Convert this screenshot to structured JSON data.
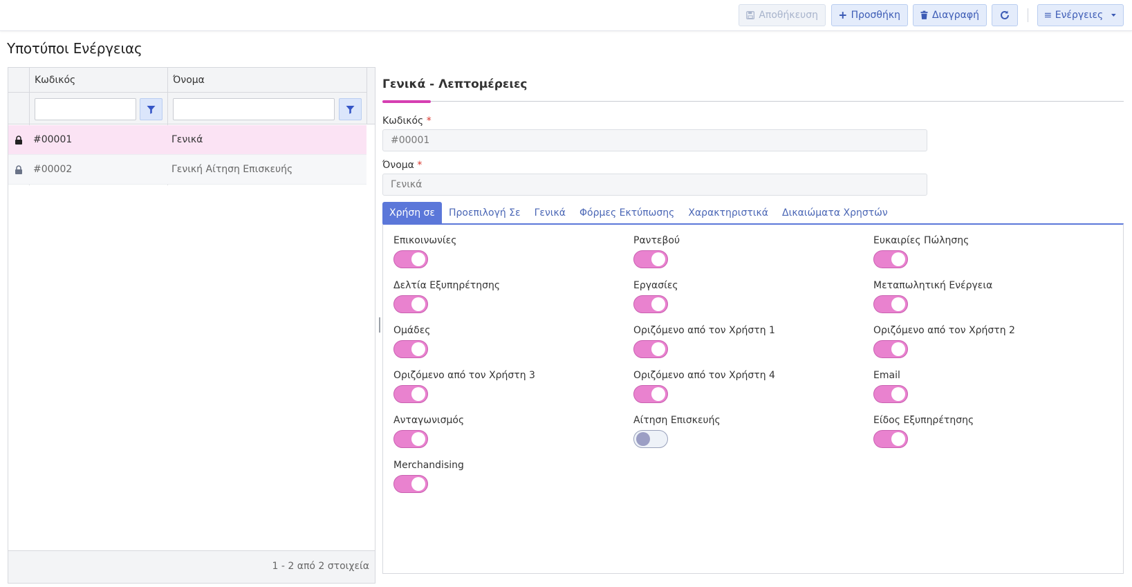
{
  "toolbar": {
    "save_label": "Αποθήκευση",
    "add_label": "Προσθήκη",
    "delete_label": "Διαγραφή",
    "actions_label": "Ενέργειες"
  },
  "page_title": "Υποτύποι Ενέργειας",
  "grid": {
    "columns": [
      "Κωδικός",
      "Όνομα"
    ],
    "rows": [
      {
        "code": "#00001",
        "name": "Γενικά",
        "selected": true
      },
      {
        "code": "#00002",
        "name": "Γενική Αίτηση Επισκευής",
        "selected": false
      }
    ],
    "footer": "1 - 2 από 2 στοιχεία"
  },
  "detail": {
    "section_title": "Γενικά - Λεπτομέρειες",
    "code_label": "Κωδικός",
    "code_value": "#00001",
    "name_label": "Όνομα",
    "name_value": "Γενικά",
    "required_mark": "*"
  },
  "tabs": [
    "Χρήση σε",
    "Προεπιλογή Σε",
    "Γενικά",
    "Φόρμες Εκτύπωσης",
    "Χαρακτηριστικά",
    "Δικαιώματα Χρηστών"
  ],
  "toggles": [
    {
      "label": "Επικοινωνίες",
      "on": true
    },
    {
      "label": "Ραντεβού",
      "on": true
    },
    {
      "label": "Ευκαιρίες Πώλησης",
      "on": true
    },
    {
      "label": "Δελτία Εξυπηρέτησης",
      "on": true
    },
    {
      "label": "Εργασίες",
      "on": true
    },
    {
      "label": "Μεταπωλητική Ενέργεια",
      "on": true
    },
    {
      "label": "Ομάδες",
      "on": true
    },
    {
      "label": "Οριζόμενο από τον Χρήστη 1",
      "on": true
    },
    {
      "label": "Οριζόμενο από τον Χρήστη 2",
      "on": true
    },
    {
      "label": "Οριζόμενο από τον Χρήστη 3",
      "on": true
    },
    {
      "label": "Οριζόμενο από τον Χρήστη 4",
      "on": true
    },
    {
      "label": "Email",
      "on": true
    },
    {
      "label": "Ανταγωνισμός",
      "on": true
    },
    {
      "label": "Αίτηση Επισκευής",
      "on": false
    },
    {
      "label": "Είδος Εξυπηρέτησης",
      "on": true
    },
    {
      "label": "Merchandising",
      "on": true
    }
  ],
  "colors": {
    "accent": "#d63fb2",
    "toggle_on": "#e982cf",
    "tab_active": "#5b77d9",
    "button_text": "#3c5bb5"
  }
}
